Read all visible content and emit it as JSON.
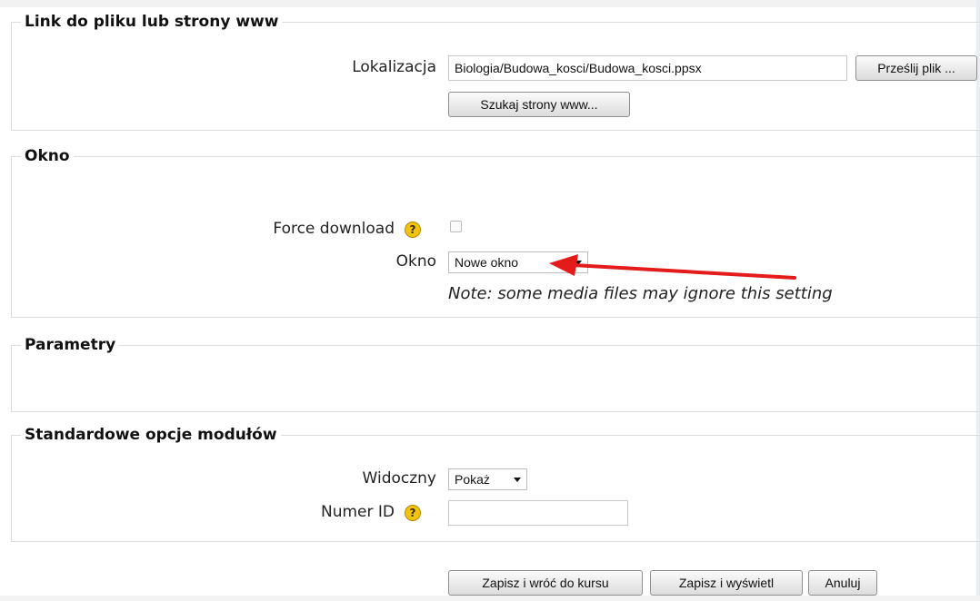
{
  "section_link": {
    "legend": "Link do pliku lub strony www",
    "location_label": "Lokalizacja",
    "location_value": "Biologia/Budowa_kosci/Budowa_kosci.ppsx",
    "upload_button": "Prześlij plik ...",
    "search_button": "Szukaj strony www..."
  },
  "section_window": {
    "legend": "Okno",
    "force_download_label": "Force download",
    "force_download_checked": false,
    "window_label": "Okno",
    "window_value": "Nowe okno",
    "note": "Note: some media files may ignore this setting"
  },
  "section_params": {
    "legend": "Parametry"
  },
  "section_module": {
    "legend": "Standardowe opcje modułów",
    "visible_label": "Widoczny",
    "visible_value": "Pokaż",
    "id_label": "Numer ID",
    "id_value": ""
  },
  "actions": {
    "save_return": "Zapisz i wróć do kursu",
    "save_display": "Zapisz i wyświetl",
    "cancel": "Anuluj"
  },
  "icons": {
    "help": "?",
    "annotation_arrow_color": "#e31b1b"
  }
}
